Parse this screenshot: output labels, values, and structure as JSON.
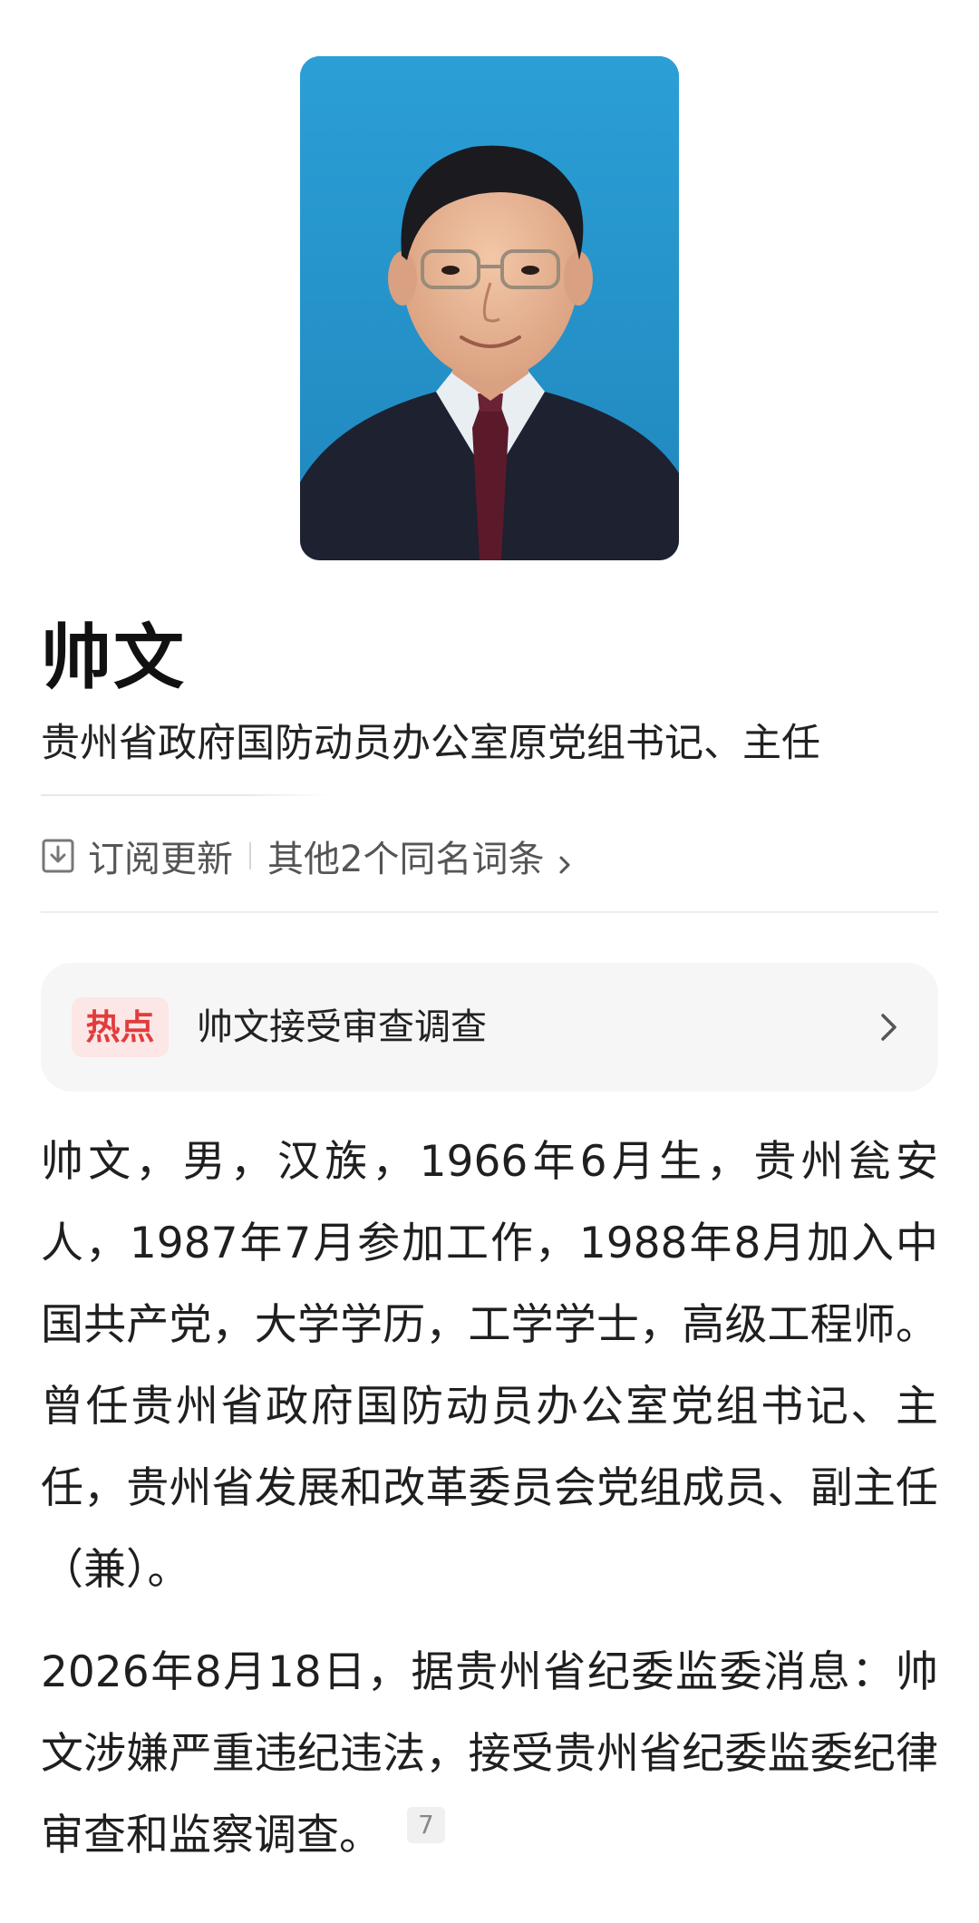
{
  "profile": {
    "name": "帅文",
    "subtitle": "贵州省政府国防动员办公室原党组书记、主任",
    "photo_icon": "portrait-photo"
  },
  "actions": {
    "subscribe_label": "订阅更新",
    "subscribe_icon": "subscribe-icon",
    "same_name_label": "其他2个同名词条",
    "chevron_icon": "chevron-right-icon"
  },
  "hot": {
    "badge": "热点",
    "text": "帅文接受审查调查",
    "chevron_icon": "chevron-right-icon",
    "badge_color": "#e23c3c",
    "badge_bg": "#fde6e6"
  },
  "content": {
    "paragraph1": "帅文，男，汉族，1966年6月生，贵州瓮安人，1987年7月参加工作，1988年8月加入中国共产党，大学学历，工学学士，高级工程师。曾任贵州省政府国防动员办公室党组书记、主任，贵州省发展和改革委员会党组成员、副主任（兼）。",
    "paragraph2": "2026年8月18日，据贵州省纪委监委消息：帅文涉嫌严重违纪违法，接受贵州省纪委监委纪律审查和监察调查。",
    "ref_number": "7"
  }
}
